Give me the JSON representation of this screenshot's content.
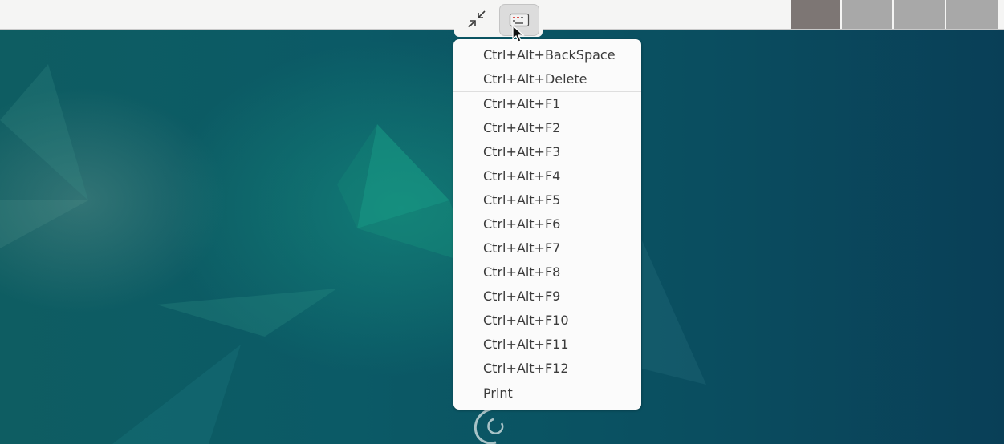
{
  "toolbar": {
    "unfullscreen_icon": "unfullscreen-icon",
    "send_keys_icon": "keyboard-icon"
  },
  "menu": {
    "groups": [
      [
        "Ctrl+Alt+BackSpace",
        "Ctrl+Alt+Delete"
      ],
      [
        "Ctrl+Alt+F1",
        "Ctrl+Alt+F2",
        "Ctrl+Alt+F3",
        "Ctrl+Alt+F4",
        "Ctrl+Alt+F5",
        "Ctrl+Alt+F6",
        "Ctrl+Alt+F7",
        "Ctrl+Alt+F8",
        "Ctrl+Alt+F9",
        "Ctrl+Alt+F10",
        "Ctrl+Alt+F11",
        "Ctrl+Alt+F12"
      ],
      [
        "Print"
      ]
    ]
  },
  "colors": {
    "desktop_teal": "#0d4f5f",
    "bar_background": "#f5f5f4",
    "menu_background": "#fbfbfb",
    "menu_text": "#3b3b3b"
  }
}
